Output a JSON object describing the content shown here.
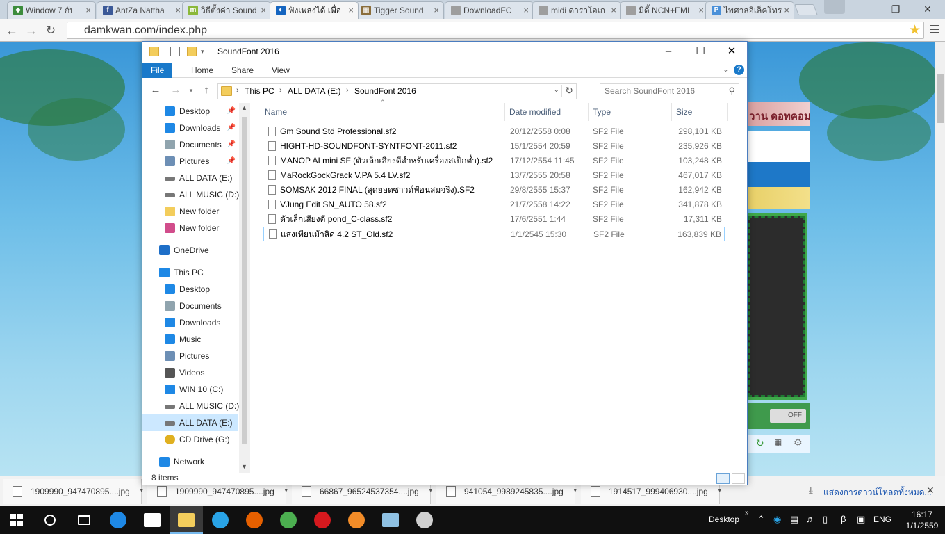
{
  "browser": {
    "tabs": [
      {
        "label": "Window 7 กับ",
        "favicon_color": "#3c8c3c",
        "favicon_char": "◆"
      },
      {
        "label": "AntZa Nattha",
        "favicon_color": "#3b5998",
        "favicon_char": "f"
      },
      {
        "label": "วิธีตั้งค่า Sound",
        "favicon_color": "#8bb83a",
        "favicon_char": "m"
      },
      {
        "label": "ฟังเพลงได้ เพื่อ",
        "favicon_color": "#1565c0",
        "favicon_char": "◐"
      },
      {
        "label": "Tigger Sound",
        "favicon_color": "#8a6d3b",
        "favicon_char": "▦"
      },
      {
        "label": "DownloadFC",
        "favicon_color": "#9e9e9e",
        "favicon_char": ""
      },
      {
        "label": "midi ดาราโอเก",
        "favicon_color": "#9e9e9e",
        "favicon_char": ""
      },
      {
        "label": "มิดี้ NCN+EMI",
        "favicon_color": "#9e9e9e",
        "favicon_char": ""
      },
      {
        "label": "ไพศาลอิเล็คโทร",
        "favicon_color": "#4a90d9",
        "favicon_char": "P"
      }
    ],
    "active_tab": 3,
    "url": "damkwan.com/index.php"
  },
  "webpage": {
    "snippet": "วาน ดอทคอม",
    "toggle_label": "OFF"
  },
  "explorer": {
    "title": "SoundFont 2016",
    "ribbon_tabs": [
      "File",
      "Home",
      "Share",
      "View"
    ],
    "breadcrumb": [
      "This PC",
      "ALL DATA (E:)",
      "SoundFont 2016"
    ],
    "search_placeholder": "Search SoundFont 2016",
    "nav": [
      {
        "label": "Desktop",
        "icon": "desktop-icon",
        "color": "#1e88e5",
        "pinned": true,
        "indent": 1
      },
      {
        "label": "Downloads",
        "icon": "download-icon",
        "color": "#1e88e5",
        "pinned": true,
        "indent": 1
      },
      {
        "label": "Documents",
        "icon": "documents-icon",
        "color": "#90a4ae",
        "pinned": true,
        "indent": 1
      },
      {
        "label": "Pictures",
        "icon": "pictures-icon",
        "color": "#6d8fb5",
        "pinned": true,
        "indent": 1
      },
      {
        "label": "ALL DATA (E:)",
        "icon": "drive-icon",
        "color": "#777777",
        "pinned": false,
        "indent": 1
      },
      {
        "label": "ALL MUSIC (D:)",
        "icon": "drive-icon",
        "color": "#777777",
        "pinned": false,
        "indent": 1
      },
      {
        "label": "New folder",
        "icon": "folder-icon",
        "color": "#f3cd5c",
        "pinned": false,
        "indent": 1
      },
      {
        "label": "New folder",
        "icon": "folder-pink-icon",
        "color": "#d14d8b",
        "pinned": false,
        "indent": 1
      },
      {
        "label": "OneDrive",
        "icon": "onedrive-icon",
        "color": "#1e6fc8",
        "pinned": false,
        "indent": 0
      },
      {
        "label": "This PC",
        "icon": "computer-icon",
        "color": "#1e88e5",
        "pinned": false,
        "indent": 0
      },
      {
        "label": "Desktop",
        "icon": "desktop-icon",
        "color": "#1e88e5",
        "pinned": false,
        "indent": 1
      },
      {
        "label": "Documents",
        "icon": "documents-icon",
        "color": "#90a4ae",
        "pinned": false,
        "indent": 1
      },
      {
        "label": "Downloads",
        "icon": "download-icon",
        "color": "#1e88e5",
        "pinned": false,
        "indent": 1
      },
      {
        "label": "Music",
        "icon": "music-icon",
        "color": "#1e88e5",
        "pinned": false,
        "indent": 1
      },
      {
        "label": "Pictures",
        "icon": "pictures-icon",
        "color": "#6d8fb5",
        "pinned": false,
        "indent": 1
      },
      {
        "label": "Videos",
        "icon": "videos-icon",
        "color": "#555555",
        "pinned": false,
        "indent": 1
      },
      {
        "label": "WIN 10 (C:)",
        "icon": "windows-drive-icon",
        "color": "#1e88e5",
        "pinned": false,
        "indent": 1
      },
      {
        "label": "ALL MUSIC (D:)",
        "icon": "drive-icon",
        "color": "#777777",
        "pinned": false,
        "indent": 1
      },
      {
        "label": "ALL DATA (E:)",
        "icon": "drive-icon",
        "color": "#777777",
        "pinned": false,
        "indent": 1,
        "selected": true
      },
      {
        "label": "CD Drive (G:)",
        "icon": "cd-drive-icon",
        "color": "#e0b020",
        "pinned": false,
        "indent": 1
      },
      {
        "label": "Network",
        "icon": "network-icon",
        "color": "#1e88e5",
        "pinned": false,
        "indent": 0
      }
    ],
    "columns": {
      "name": "Name",
      "date": "Date modified",
      "type": "Type",
      "size": "Size"
    },
    "files": [
      {
        "name": "Gm Sound Std Professional.sf2",
        "date": "20/12/2558 0:08",
        "type": "SF2 File",
        "size": "298,101 KB"
      },
      {
        "name": "HIGHT-HD-SOUNDFONT-SYNTFONT-2011.sf2",
        "date": "15/1/2554 20:59",
        "type": "SF2 File",
        "size": "235,926 KB"
      },
      {
        "name": "MANOP AI mini SF (ตัวเล็กเสียงดีสำหรับเครื่องสเป็กต่ำ).sf2",
        "date": "17/12/2554 11:45",
        "type": "SF2 File",
        "size": "103,248 KB"
      },
      {
        "name": "MaRockGockGrack V.PA 5.4 LV.sf2",
        "date": "13/7/2555 20:58",
        "type": "SF2 File",
        "size": "467,017 KB"
      },
      {
        "name": "SOMSAK 2012 FINAL (สุดยอดซาวด์ฟ้อนสมจริง).SF2",
        "date": "29/8/2555 15:37",
        "type": "SF2 File",
        "size": "162,942 KB"
      },
      {
        "name": "VJung Edit  SN_AUTO 58.sf2",
        "date": "21/7/2558 14:22",
        "type": "SF2 File",
        "size": "341,878 KB"
      },
      {
        "name": "ตัวเล็กเสียงดี pond_C-class.sf2",
        "date": "17/6/2551 1:44",
        "type": "SF2 File",
        "size": "17,311 KB"
      },
      {
        "name": "แสงเทียนม้าสิด 4.2 ST_Old.sf2",
        "date": "1/1/2545 15:30",
        "type": "SF2 File",
        "size": "163,839 KB"
      }
    ],
    "status": "8 items"
  },
  "downloads": {
    "items": [
      "1909990_947470895....jpg",
      "1909990_947470895....jpg",
      "66867_96524537354....jpg",
      "941054_9989245835....jpg",
      "1914517_999406930....jpg"
    ],
    "show_all": "แสดงการดาวน์โหลดทั้งหมด..."
  },
  "taskbar": {
    "apps": [
      {
        "name": "cortana",
        "color": "#101010"
      },
      {
        "name": "task-view",
        "color": "#101010"
      },
      {
        "name": "edge",
        "color": "#1e88e5"
      },
      {
        "name": "store",
        "color": "#ffffff"
      },
      {
        "name": "file-explorer",
        "color": "#f3cd5c"
      },
      {
        "name": "internet-explorer",
        "color": "#29a3e6"
      },
      {
        "name": "firefox",
        "color": "#e66000"
      },
      {
        "name": "chrome",
        "color": "#4caf50"
      },
      {
        "name": "opera",
        "color": "#d6191e"
      },
      {
        "name": "avast",
        "color": "#f28c28"
      },
      {
        "name": "notepad",
        "color": "#8fc1e3"
      },
      {
        "name": "paint",
        "color": "#d0d0d0"
      }
    ],
    "active_app": 4,
    "desktop_label": "Desktop",
    "language": "ENG",
    "time": "16:17",
    "date": "1/1/2559"
  }
}
